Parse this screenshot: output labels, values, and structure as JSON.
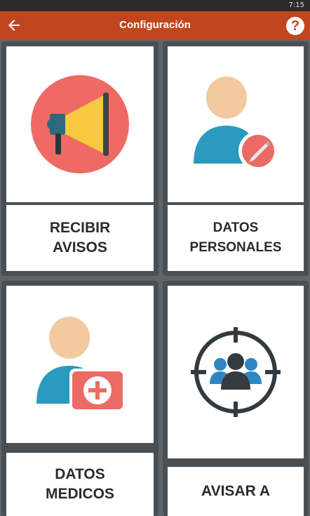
{
  "status_bar": {
    "time": "7:15"
  },
  "app_bar": {
    "title": "Configuración",
    "help_label": "?"
  },
  "colors": {
    "app_bar": "#c2461d",
    "background": "#5f6468",
    "card_border": "#4a4f53"
  },
  "cards": [
    {
      "label": "RECIBIR\nAVISOS",
      "icon": "megaphone-icon"
    },
    {
      "label": "DATOS\nPERSONALES",
      "icon": "user-edit-icon"
    },
    {
      "label": "DATOS\nMEDICOS",
      "icon": "user-medical-icon"
    },
    {
      "label": "AVISAR A",
      "icon": "target-group-icon"
    }
  ]
}
